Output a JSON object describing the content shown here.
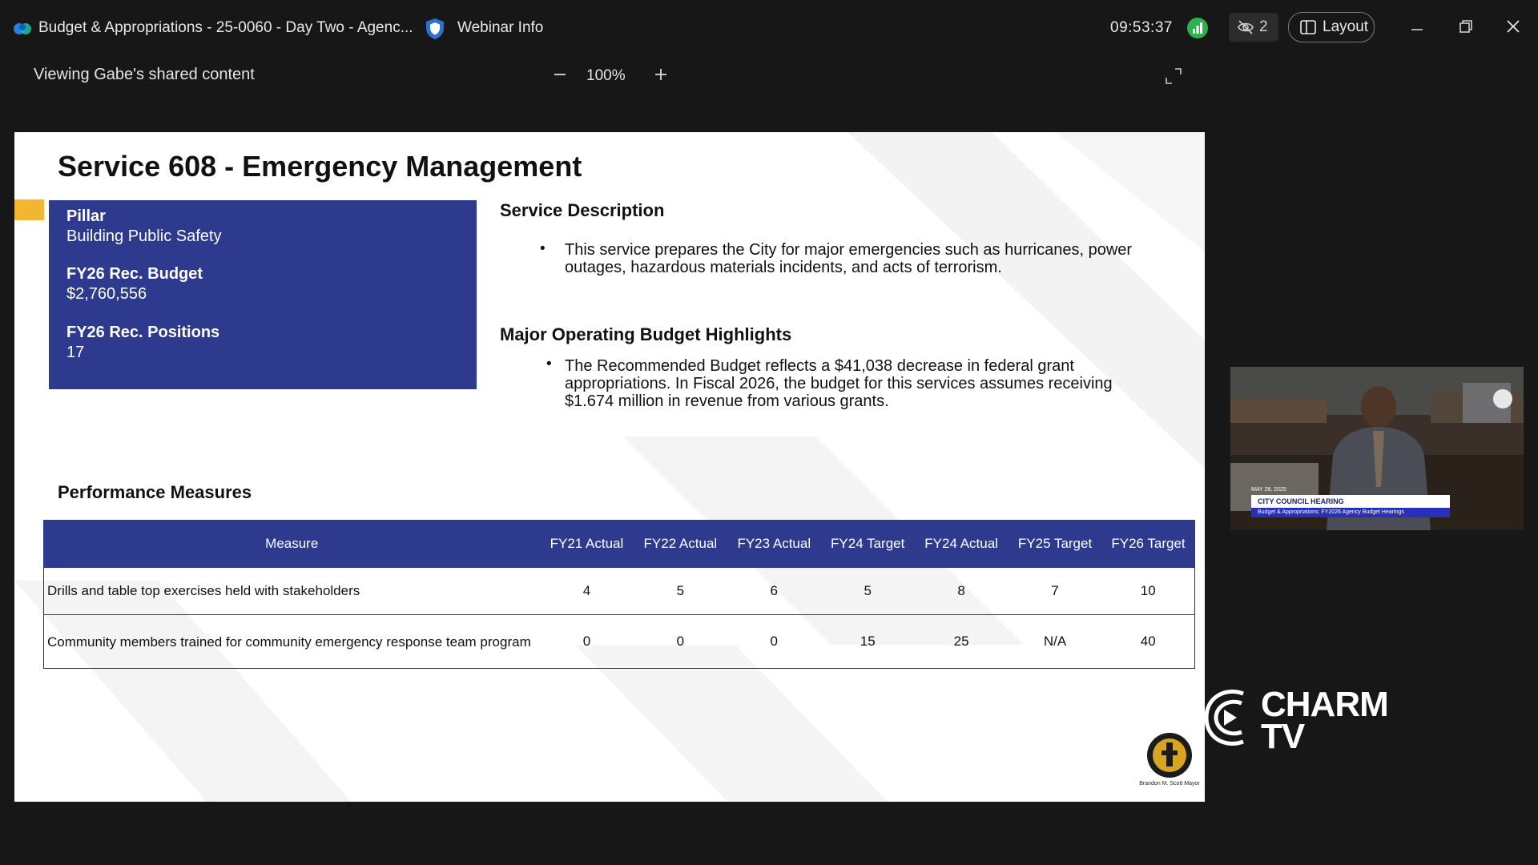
{
  "window": {
    "title": "Budget & Appropriations - 25-0060 - Day Two - Agenc...",
    "webinar_info": "Webinar Info",
    "clock": "09:53:37",
    "hidden_count": "2",
    "layout_label": "Layout"
  },
  "share": {
    "label": "Viewing Gabe's shared content",
    "zoom": "100%"
  },
  "slide": {
    "title": "Service 608 - Emergency Management",
    "pillar_heading": "Pillar",
    "pillar_value": "Building Public Safety",
    "budget_heading": "FY26 Rec. Budget",
    "budget_value": "$2,760,556",
    "positions_heading": "FY26 Rec. Positions",
    "positions_value": "17",
    "service_description_heading": "Service Description",
    "service_description_text": "This service prepares the City for major emergencies such as hurricanes, power outages, hazardous materials incidents, and acts of terrorism.",
    "highlights_heading": "Major Operating Budget Highlights",
    "highlights_text": "The Recommended Budget reflects a $41,038 decrease in federal grant appropriations.  In Fiscal 2026, the budget for this services assumes receiving $1.674 million in revenue from various grants.",
    "performance_heading": "Performance Measures",
    "table": {
      "headers": [
        "Measure",
        "FY21 Actual",
        "FY22 Actual",
        "FY23 Actual",
        "FY24 Target",
        "FY24 Actual",
        "FY25 Target",
        "FY26 Target"
      ],
      "rows": [
        [
          "Drills and table top exercises held with stakeholders",
          "4",
          "5",
          "6",
          "5",
          "8",
          "7",
          "10"
        ],
        [
          "Community members trained for community emergency response team program",
          "0",
          "0",
          "0",
          "15",
          "25",
          "N/A",
          "40"
        ]
      ]
    },
    "seal_caption": "Brandon M. Scott Mayor"
  },
  "video": {
    "date": "MAY 28, 2025",
    "banner_title": "CITY COUNCIL HEARING",
    "banner_subtitle": "Budget & Appropriations: FY2026 Agency Budget Hearings"
  },
  "watermark": {
    "line1": "CHARM",
    "line2": "TV"
  },
  "colors": {
    "slide_blue": "#2e3a8e",
    "accent_yellow": "#f2b632",
    "status_green": "#2bb24c"
  }
}
